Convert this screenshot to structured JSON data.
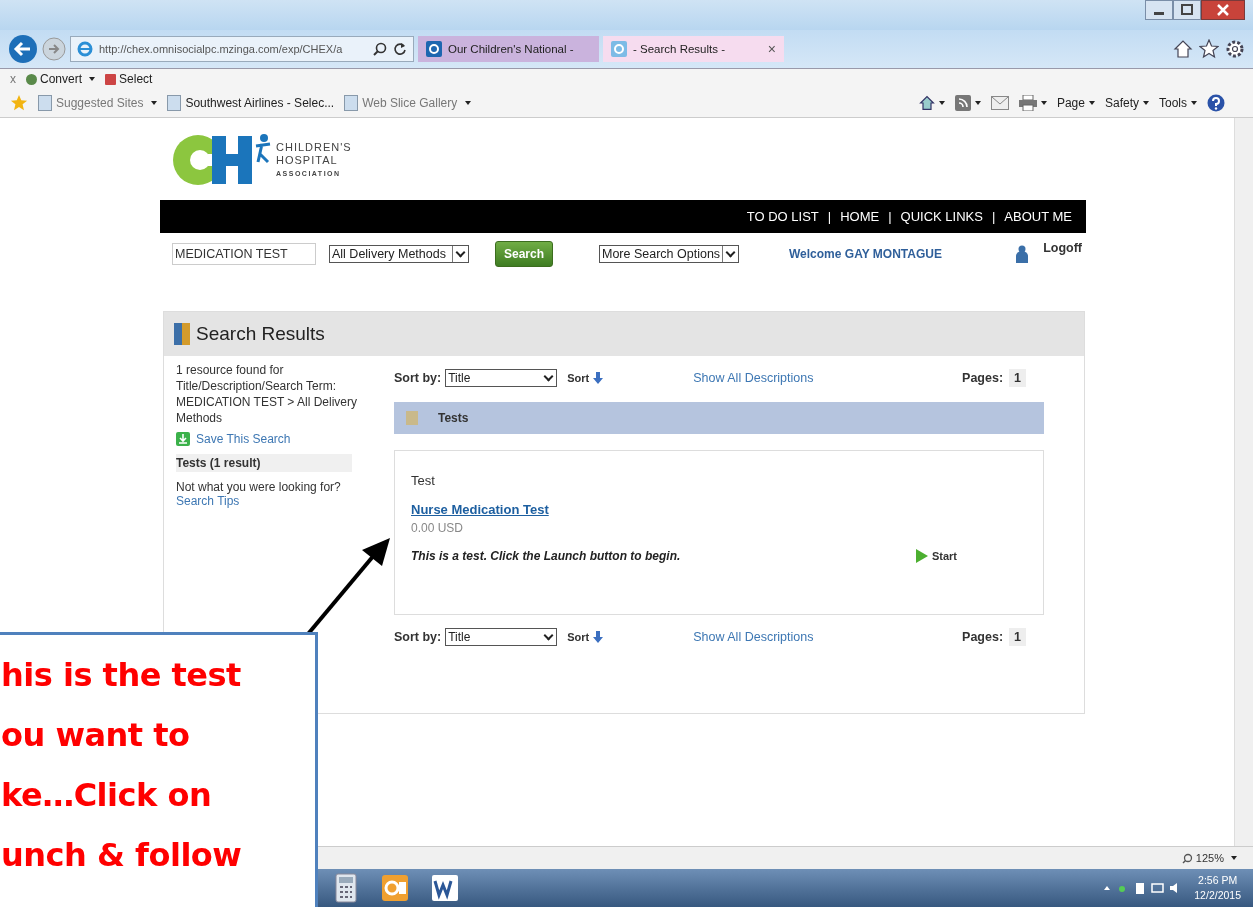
{
  "browser": {
    "address": "http://chex.omnisocialpc.mzinga.com/exp/CHEX/a",
    "tabs": [
      {
        "label": "Our Children's National -",
        "selected": false,
        "closable": false
      },
      {
        "label": "- Search Results -",
        "selected": true,
        "closable": true
      }
    ],
    "close_glyph": "×",
    "command_bar": {
      "close": "x",
      "items": [
        "Convert",
        "Select"
      ]
    },
    "favorites": [
      {
        "label": "Suggested Sites",
        "dropdown": true,
        "dim": true
      },
      {
        "label": "Southwest Airlines - Selec...",
        "dropdown": false,
        "dim": false
      },
      {
        "label": "Web Slice Gallery",
        "dropdown": true,
        "dim": true
      }
    ],
    "tools": [
      "Page",
      "Safety",
      "Tools"
    ],
    "zoom": "125%"
  },
  "site": {
    "logo": [
      "CHILDREN'S",
      "HOSPITAL",
      "ASSOCIATION"
    ],
    "nav": [
      "TO DO LIST",
      "HOME",
      "QUICK LINKS",
      "ABOUT ME"
    ],
    "nav_separator": "|",
    "search_value": "MEDICATION TEST",
    "delivery": "All Delivery Methods",
    "search_button": "Search",
    "more_options": "More Search Options",
    "welcome": "Welcome GAY MONTAGUE",
    "logoff": "Logoff"
  },
  "results": {
    "title": "Search Results",
    "summary": "1 resource found for Title/Description/Search Term: MEDICATION TEST > All Delivery Methods",
    "save_search": "Save This Search",
    "facet": "Tests (1 result)",
    "not_found": "Not what you were looking for?",
    "tips": "Search Tips",
    "toolbars": [
      {
        "sort_label": "Sort by:",
        "sort_value": "Title",
        "sort": "Sort",
        "show_all": "Show All Descriptions",
        "pages_label": "Pages:",
        "page": "1"
      },
      {
        "sort_label": "Sort by:",
        "sort_value": "Title",
        "sort": "Sort",
        "show_all": "Show All Descriptions",
        "pages_label": "Pages:",
        "page": "1"
      }
    ],
    "group": "Tests",
    "item": {
      "type": "Test",
      "title": "Nurse Medication Test",
      "price": "0.00  USD",
      "description": "This is a test. Click the Launch button to begin.",
      "action": "Start"
    }
  },
  "callout": {
    "lines": [
      "his is the test",
      "ou want to",
      "ke…Click on",
      "unch & follow"
    ]
  },
  "taskbar": {
    "time": "2:56 PM",
    "date": "12/2/2015"
  }
}
